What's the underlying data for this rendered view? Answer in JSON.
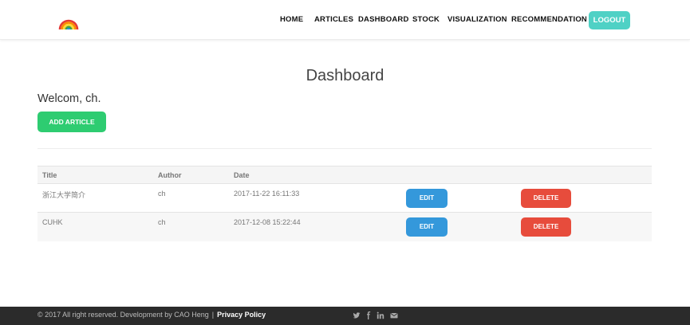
{
  "nav": {
    "items": [
      "HOME",
      "ARTICLES",
      "DASHBOARD",
      "STOCK",
      "VISUALIZATION",
      "RECOMMENDATION"
    ],
    "logout": "LOGOUT"
  },
  "main": {
    "title": "Dashboard",
    "welcome": "Welcom, ch.",
    "add_article": "ADD ARTICLE"
  },
  "table": {
    "headers": [
      "Title",
      "Author",
      "Date"
    ],
    "rows": [
      {
        "title": "浙江大学简介",
        "author": "ch",
        "date": "2017-11-22 16:11:33",
        "edit": "EDIT",
        "delete": "DELETE"
      },
      {
        "title": "CUHK",
        "author": "ch",
        "date": "2017-12-08 15:22:44",
        "edit": "EDIT",
        "delete": "DELETE"
      }
    ]
  },
  "footer": {
    "copyright": "© 2017 All right reserved. Development by CAO Heng",
    "separator": "|",
    "privacy": "Privacy Policy",
    "social_icons": [
      "twitter-icon",
      "facebook-icon",
      "linkedin-icon",
      "envelope-icon"
    ]
  },
  "colors": {
    "logout": "#4fd1c5",
    "add": "#2ecc71",
    "edit": "#3498db",
    "delete": "#e74c3c",
    "footer": "#2b2b2b"
  }
}
